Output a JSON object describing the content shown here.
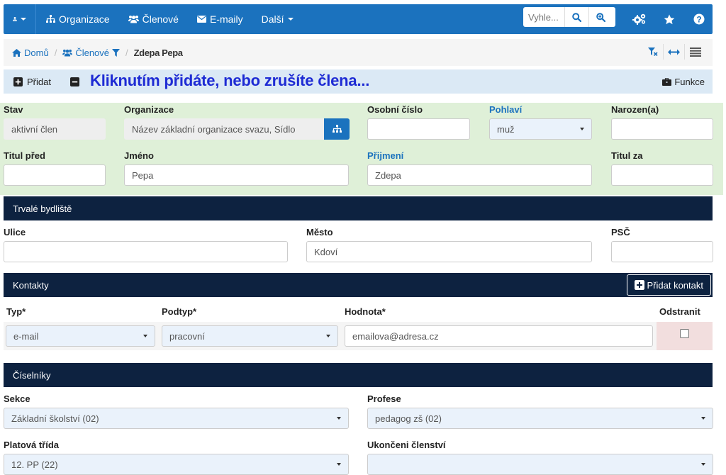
{
  "navbar": {
    "organizace_label": "Organizace",
    "clenove_label": "Členové",
    "emaily_label": "E-maily",
    "dalsi_label": "Další",
    "search_placeholder": "Vyhle..."
  },
  "breadcrumb": {
    "home": "Domů",
    "members": "Členové",
    "current": "Zdepa Pepa"
  },
  "actions": {
    "add": "Přidat",
    "tooltip": "Kliknutím přidáte, nebo zrušíte člena...",
    "funkce": "Funkce"
  },
  "member": {
    "stav_label": "Stav",
    "stav_value": "aktivní člen",
    "organizace_label": "Organizace",
    "organizace_value": "Název základní organizace svazu, Sídlo",
    "osobni_cislo_label": "Osobní číslo",
    "osobni_cislo_value": "",
    "pohlavi_label": "Pohlaví",
    "pohlavi_value": "muž",
    "narozen_label": "Narozen(a)",
    "narozen_value": "",
    "titul_pred_label": "Titul před",
    "titul_pred_value": "",
    "jmeno_label": "Jméno",
    "jmeno_value": "Pepa",
    "prijmeni_label": "Přijmení",
    "prijmeni_value": "Zdepa",
    "titul_za_label": "Titul za",
    "titul_za_value": ""
  },
  "address": {
    "header": "Trvalé bydliště",
    "ulice_label": "Ulice",
    "ulice_value": "",
    "mesto_label": "Město",
    "mesto_value": "Kdoví",
    "psc_label": "PSČ",
    "psc_value": ""
  },
  "contacts": {
    "header": "Kontakty",
    "add_button": "Přidat kontakt",
    "col_typ": "Typ*",
    "col_podtyp": "Podtyp*",
    "col_hodnota": "Hodnota*",
    "col_odstranit": "Odstranit",
    "rows": [
      {
        "typ": "e-mail",
        "podtyp": "pracovní",
        "hodnota": "emailova@adresa.cz",
        "odstranit": false
      }
    ]
  },
  "ciselniky": {
    "header": "Číselníky",
    "sekce_label": "Sekce",
    "sekce_value": "Základní školství (02)",
    "profese_label": "Profese",
    "profese_value": "pedagog zš (02)",
    "platova_trida_label": "Platová třída",
    "platova_trida_value": "12. PP (22)",
    "ukonceni_label": "Ukončeni členství",
    "ukonceni_value": ""
  },
  "colors": {
    "navbar": "#1b72be",
    "section_header": "#0d2240",
    "form_bg": "#dff0d8",
    "action_bar": "#dbe9f5",
    "tooltip_text": "#1e2bd4",
    "delete_cell": "#f2dede"
  }
}
